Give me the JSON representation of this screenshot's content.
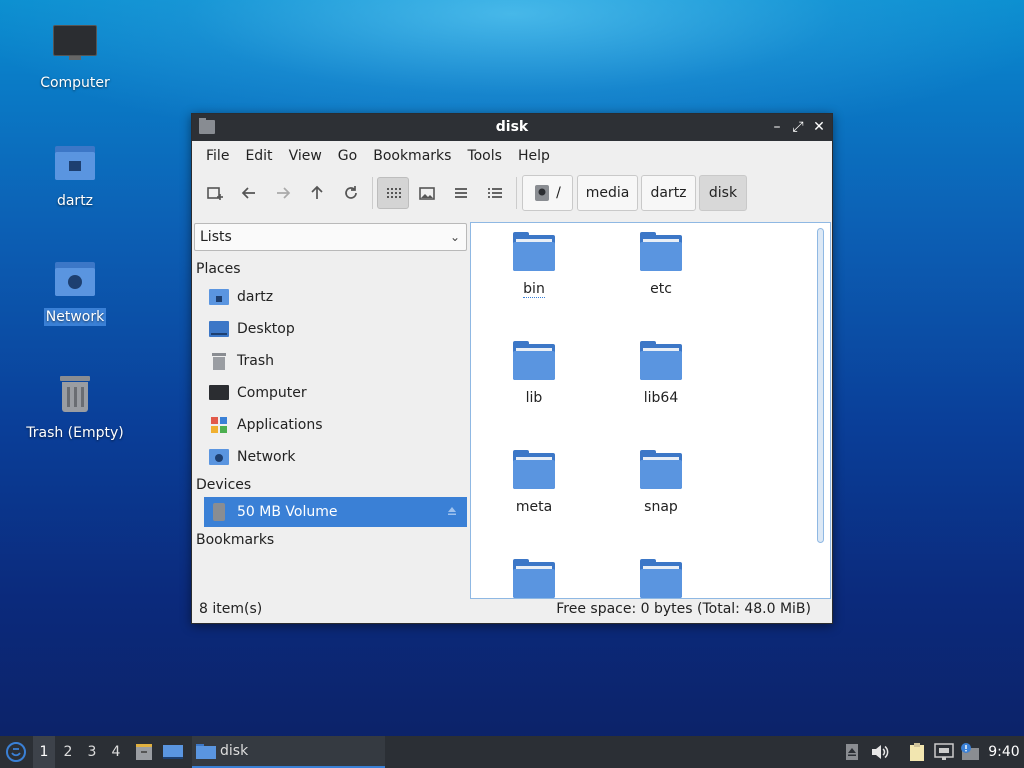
{
  "desktop": {
    "icons": [
      {
        "label": "Computer"
      },
      {
        "label": "dartz"
      },
      {
        "label": "Network"
      },
      {
        "label": "Trash (Empty)"
      }
    ]
  },
  "window": {
    "title": "disk",
    "menu": [
      "File",
      "Edit",
      "View",
      "Go",
      "Bookmarks",
      "Tools",
      "Help"
    ],
    "path": {
      "root": "/",
      "segments": [
        "media",
        "dartz",
        "disk"
      ]
    },
    "side": {
      "mode": "Lists",
      "places_header": "Places",
      "places": [
        "dartz",
        "Desktop",
        "Trash",
        "Computer",
        "Applications",
        "Network"
      ],
      "devices_header": "Devices",
      "devices": [
        "50 MB Volume"
      ],
      "bookmarks_header": "Bookmarks"
    },
    "files": [
      "bin",
      "etc",
      "lib",
      "lib64",
      "meta",
      "snap",
      "",
      ""
    ],
    "status": {
      "count": "8 item(s)",
      "space": "Free space: 0 bytes (Total: 48.0 MiB)"
    }
  },
  "taskbar": {
    "workspaces": [
      "1",
      "2",
      "3",
      "4"
    ],
    "task": "disk",
    "clock": "9:40"
  },
  "colors": {
    "accent": "#3a80d6",
    "folder": "#5a95e0",
    "titlebar": "#2d3035"
  }
}
